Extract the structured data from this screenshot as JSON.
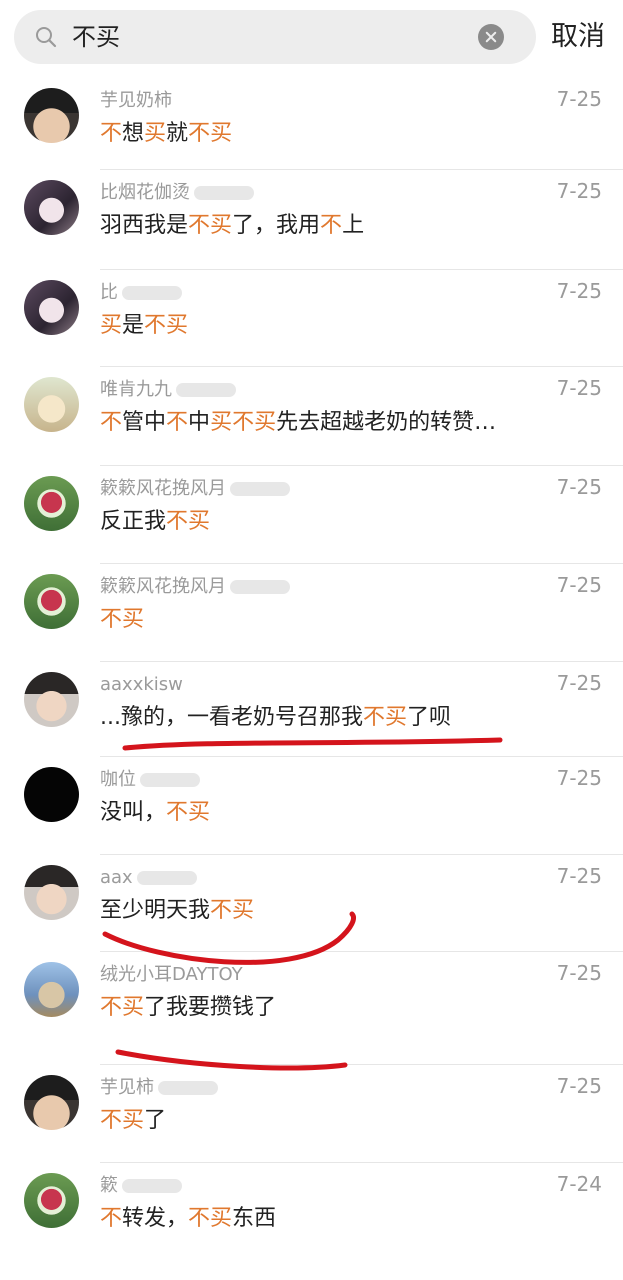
{
  "search": {
    "query": "不买",
    "cancel_label": "取消"
  },
  "results": [
    {
      "name": "芋见奶柿",
      "date": "7-25",
      "message": [
        {
          "t": "不",
          "h": true
        },
        {
          "t": "想",
          "h": false
        },
        {
          "t": "买",
          "h": true
        },
        {
          "t": "就",
          "h": false
        },
        {
          "t": "不买",
          "h": true
        }
      ]
    },
    {
      "name": "比烟花伽烫",
      "date": "7-25",
      "message": [
        {
          "t": "羽西我是",
          "h": false
        },
        {
          "t": "不买",
          "h": true
        },
        {
          "t": "了，我用",
          "h": false
        },
        {
          "t": "不",
          "h": true
        },
        {
          "t": "上",
          "h": false
        }
      ]
    },
    {
      "name": "比",
      "date": "7-25",
      "message": [
        {
          "t": "买",
          "h": true
        },
        {
          "t": "是",
          "h": false
        },
        {
          "t": "不买",
          "h": true
        }
      ]
    },
    {
      "name": "唯肯九九",
      "date": "7-25",
      "message": [
        {
          "t": "不",
          "h": true
        },
        {
          "t": "管中",
          "h": false
        },
        {
          "t": "不",
          "h": true
        },
        {
          "t": "中",
          "h": false
        },
        {
          "t": "买不买",
          "h": true
        },
        {
          "t": "先去超越老奶的转赞…",
          "h": false
        }
      ]
    },
    {
      "name": "簌簌风花挽风月",
      "date": "7-25",
      "message": [
        {
          "t": "反正我",
          "h": false
        },
        {
          "t": "不买",
          "h": true
        }
      ]
    },
    {
      "name": "簌簌风花挽风月",
      "date": "7-25",
      "message": [
        {
          "t": "不买",
          "h": true
        }
      ]
    },
    {
      "name": "aaxxkisw",
      "date": "7-25",
      "message": [
        {
          "t": "...豫的，一看老奶号召那我",
          "h": false
        },
        {
          "t": "不买",
          "h": true
        },
        {
          "t": "了呗",
          "h": false
        }
      ]
    },
    {
      "name": "咖位",
      "date": "7-25",
      "message": [
        {
          "t": "没叫，",
          "h": false
        },
        {
          "t": "不买",
          "h": true
        }
      ]
    },
    {
      "name": "aax",
      "date": "7-25",
      "message": [
        {
          "t": "至少明天我",
          "h": false
        },
        {
          "t": "不买",
          "h": true
        }
      ]
    },
    {
      "name": "绒光小耳DAYTOY",
      "date": "7-25",
      "message": [
        {
          "t": "不买",
          "h": true
        },
        {
          "t": "了我要攒钱了",
          "h": false
        }
      ]
    },
    {
      "name": "芋见柿",
      "date": "7-25",
      "message": [
        {
          "t": "不买",
          "h": true
        },
        {
          "t": "了",
          "h": false
        }
      ]
    },
    {
      "name": "簌",
      "date": "7-24",
      "message": [
        {
          "t": "不",
          "h": true
        },
        {
          "t": "转发，",
          "h": false
        },
        {
          "t": "不买",
          "h": true
        },
        {
          "t": "东西",
          "h": false
        }
      ]
    }
  ],
  "colors": {
    "highlight": "#e0782e",
    "annotation": "#d4141c",
    "meta": "#9a9a9a"
  },
  "icons": {
    "search": "search-icon",
    "clear": "clear-icon"
  }
}
